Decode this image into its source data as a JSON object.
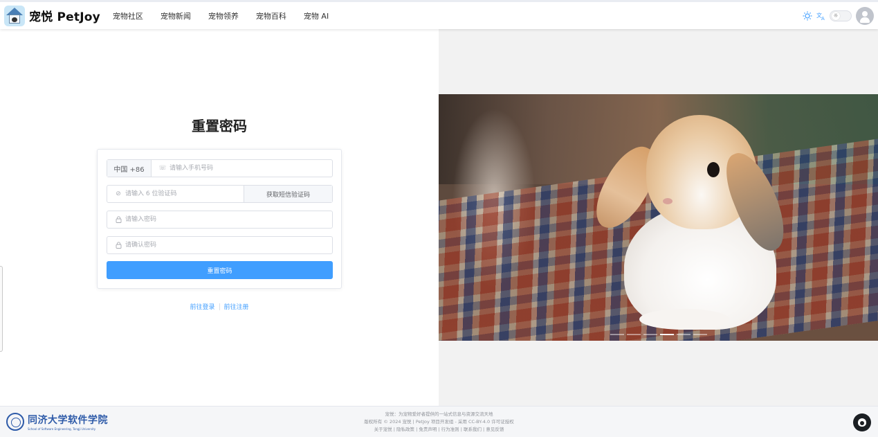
{
  "brand": {
    "name": "宠悦 PetJoy"
  },
  "nav": {
    "items": [
      {
        "label": "宠物社区"
      },
      {
        "label": "宠物新闻"
      },
      {
        "label": "宠物领养"
      },
      {
        "label": "宠物百科"
      },
      {
        "label": "宠物 AI"
      }
    ]
  },
  "header_tools": {
    "theme_icon": "sun-icon",
    "translate_icon": "translate-icon",
    "theme_switch_icon": "☼",
    "avatar_icon": "user-icon"
  },
  "form": {
    "title": "重置密码",
    "phone": {
      "prefix": "中国 +86",
      "placeholder": "请输入手机号码",
      "icon": "☏"
    },
    "code": {
      "placeholder": "请输入 6 位验证码",
      "icon": "⊘",
      "button": "获取短信验证码"
    },
    "password": {
      "placeholder": "请输入密码",
      "icon": "🔒"
    },
    "confirm": {
      "placeholder": "请确认密码",
      "icon": "🔒"
    },
    "submit": "重置密码"
  },
  "links": {
    "login": "前往登录",
    "register": "前往注册"
  },
  "carousel": {
    "count": 6,
    "active_index": 3
  },
  "footer": {
    "school_cn": "同济大学软件学院",
    "school_en": "School of Software Engineering, Tongji University",
    "line1": "宠悦：为宠物爱好者提供的一站式信息与资源交流天地",
    "line2": "版权所有 © 2024 宠悦 | PetJoy 项目开发组 - 采用 CC-BY-4.0 许可证授权",
    "line3_links": [
      "关于宠悦",
      "隐私政策",
      "免责声明",
      "行为准则",
      "联系我们",
      "意见反馈"
    ]
  },
  "colors": {
    "primary": "#409eff",
    "school": "#2d5aa8"
  }
}
